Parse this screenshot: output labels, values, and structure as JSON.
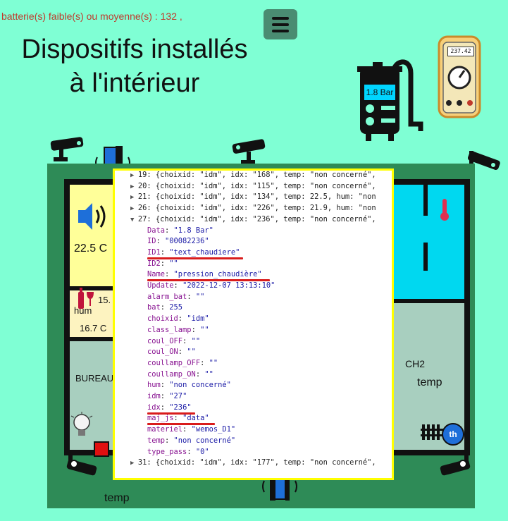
{
  "header": {
    "battery_warning": "batterie(s) faible(s) ou moyenne(s) : 132 ,",
    "title_line1": "Dispositifs installés",
    "title_line2": "à l'intérieur",
    "menu_icon": "hamburger-icon"
  },
  "gauges": {
    "boiler_pressure": "1.8 Bar",
    "multimeter_reading": "237.42"
  },
  "rooms": {
    "living_temp": "22.5 C",
    "hum_label": "hum",
    "hum_value": "15.",
    "temp_value2": "16.7 C",
    "office_label": "BUREAU",
    "ch2_label": "CH2",
    "ch2_temp_label": "temp",
    "bottom_temp_label": "temp",
    "radiator_label": "th"
  },
  "console": {
    "collapsed_before": [
      {
        "prefix": "19: {",
        "text": "choixid: \"idm\", idx: \"168\", temp: \"non concerné\","
      },
      {
        "prefix": "20: {",
        "text": "choixid: \"idm\", idx: \"115\", temp: \"non concerné\","
      },
      {
        "prefix": "21: {",
        "text": "choixid: \"idm\", idx: \"134\", temp: 22.5, hum: \"non"
      },
      {
        "prefix": "26: {",
        "text": "choixid: \"idm\", idx: \"226\", temp: 21.9, hum: \"non"
      }
    ],
    "expanded_header": {
      "prefix": "27: {",
      "text": "choixid: \"idm\", idx: \"236\", temp: \"non concerné\","
    },
    "properties": [
      {
        "key": "Data",
        "value": "\"1.8 Bar\""
      },
      {
        "key": "ID",
        "value": "\"00082236\""
      },
      {
        "key": "ID1",
        "value": "\"text_chaudiere\""
      },
      {
        "key": "ID2",
        "value": "\"\""
      },
      {
        "key": "Name",
        "value": "\"pression_chaudière\""
      },
      {
        "key": "Update",
        "value": "\"2022-12-07 13:13:10\""
      },
      {
        "key": "alarm_bat",
        "value": "\"\""
      },
      {
        "key": "bat",
        "value": "255"
      },
      {
        "key": "choixid",
        "value": "\"idm\""
      },
      {
        "key": "class_lamp",
        "value": "\"\""
      },
      {
        "key": "coul_OFF",
        "value": "\"\""
      },
      {
        "key": "coul_ON",
        "value": "\"\""
      },
      {
        "key": "coullamp_OFF",
        "value": "\"\""
      },
      {
        "key": "coullamp_ON",
        "value": "\"\""
      },
      {
        "key": "hum",
        "value": "\"non concerné\""
      },
      {
        "key": "idm",
        "value": "\"27\""
      },
      {
        "key": "idx",
        "value": "\"236\""
      },
      {
        "key": "maj_js",
        "value": "\"data\""
      },
      {
        "key": "materiel",
        "value": "\"wemos_D1\""
      },
      {
        "key": "temp",
        "value": "\"non concerné\""
      },
      {
        "key": "type_pass",
        "value": "\"0\""
      }
    ],
    "collapsed_after": [
      {
        "prefix": "31: {",
        "text": "choixid: \"idm\", idx: \"177\", temp: \"non concerné\","
      }
    ]
  },
  "colors": {
    "background": "#7fffd4",
    "floor": "#2e8b57",
    "console_border": "#ffff00",
    "highlight": "#d91c1c",
    "menu_button": "#4a8c72"
  }
}
